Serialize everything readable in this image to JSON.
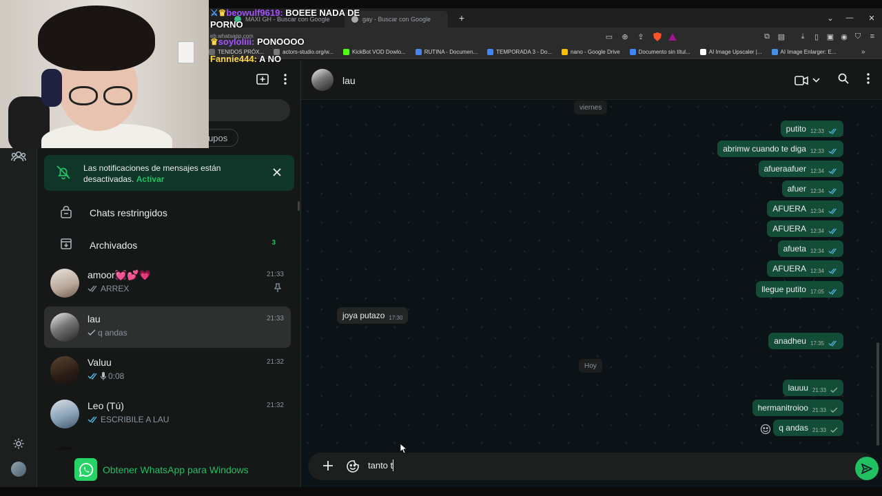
{
  "browser": {
    "tabs": [
      "MAXI GH - Buscar con Google",
      "gay - Buscar con Google"
    ],
    "address_fragment": "eb.whatsapp.com",
    "bookmarks": [
      {
        "label": "TENIDOS PRÓX...",
        "color": "#6a6a6a"
      },
      {
        "label": "actors-studio.org/w...",
        "color": "#7a7a7a"
      },
      {
        "label": "KickBot VOD Dowlo...",
        "color": "#53fc18"
      },
      {
        "label": "RUTINA - Documen...",
        "color": "#4285f4"
      },
      {
        "label": "TEMPORADA 3 - Do...",
        "color": "#4285f4"
      },
      {
        "label": "nano - Google Drive",
        "color": "#fbbc04"
      },
      {
        "label": "Documento sin títul...",
        "color": "#4285f4"
      },
      {
        "label": "AI Image Upscaler |...",
        "color": "#ffffff"
      },
      {
        "label": "AI Image Enlarger: E...",
        "color": "#4a90e2"
      }
    ]
  },
  "stream_chat": [
    {
      "user": "beowulf9619:",
      "message": "BOEEE NADA DE PORNO",
      "line1": "BOEEE NADA DE",
      "line2": "PORNO",
      "color": "#a454ff"
    },
    {
      "user": "soyloliii:",
      "message": "PONOOOO",
      "color": "#a454ff"
    },
    {
      "user": "Fannie444:",
      "message": "A NO",
      "color": "#ffd54a"
    }
  ],
  "sidebar": {
    "groups_chip": "Grupos",
    "groups_chip_visible": "rupos",
    "notification": {
      "text": "Las notificaciones de mensajes están desactivadas.",
      "action": "Activar"
    },
    "restricted_label": "Chats restringidos",
    "archived_label": "Archivados",
    "archived_count": "3",
    "chats": [
      {
        "name": "amoor💓💕💗",
        "time": "21:33",
        "preview": "ARREX",
        "status": "read",
        "pinned": true
      },
      {
        "name": "lau",
        "time": "21:33",
        "preview": "q andas",
        "status": "sent",
        "pinned": false
      },
      {
        "name": "Valuu",
        "time": "21:32",
        "preview": "0:08",
        "status": "read",
        "voice": true
      },
      {
        "name": "Leo (Tú)",
        "time": "21:32",
        "preview": "ESCRIBILE A LAU",
        "status": "read"
      }
    ],
    "get_app_label": "Obtener WhatsApp para Windows"
  },
  "conversation": {
    "contact_name": "lau",
    "day_labels": [
      "viernes",
      "Hoy"
    ],
    "messages": [
      {
        "text": "putito",
        "time": "12:33",
        "dir": "out",
        "status": "read"
      },
      {
        "text": "abrimw cuando te diga",
        "time": "12:33",
        "dir": "out",
        "status": "read"
      },
      {
        "text": "afueraafuer",
        "time": "12:34",
        "dir": "out",
        "status": "read"
      },
      {
        "text": "afuer",
        "time": "12:34",
        "dir": "out",
        "status": "read"
      },
      {
        "text": "AFUERA",
        "time": "12:34",
        "dir": "out",
        "status": "read"
      },
      {
        "text": "AFUERA",
        "time": "12:34",
        "dir": "out",
        "status": "read"
      },
      {
        "text": "afueta",
        "time": "12:34",
        "dir": "out",
        "status": "read"
      },
      {
        "text": "AFUERA",
        "time": "12:34",
        "dir": "out",
        "status": "read"
      },
      {
        "text": "llegue putito",
        "time": "17:05",
        "dir": "out",
        "status": "read"
      },
      {
        "text": "joya putazo",
        "time": "17:30",
        "dir": "in"
      },
      {
        "text": "anadheu",
        "time": "17:35",
        "dir": "out",
        "status": "read"
      },
      {
        "text": "lauuu",
        "time": "21:33",
        "dir": "out",
        "status": "sent"
      },
      {
        "text": "hermanitroioo",
        "time": "21:33",
        "dir": "out",
        "status": "sent"
      },
      {
        "text": "q andas",
        "time": "21:33",
        "dir": "out",
        "status": "sent"
      }
    ],
    "composer_value": "tanto t"
  },
  "colors": {
    "accent": "#21c063",
    "outgoing_bubble": "#144d37",
    "incoming_bubble": "#242626",
    "read_tick": "#53bdeb"
  }
}
